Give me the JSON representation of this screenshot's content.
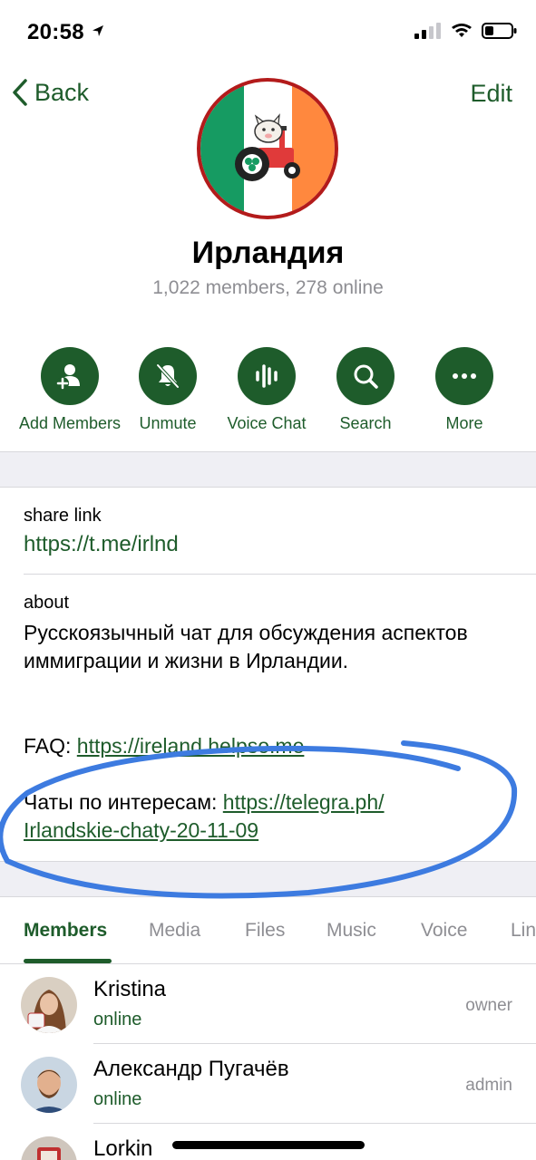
{
  "status_bar": {
    "time": "20:58"
  },
  "nav": {
    "back_label": "Back",
    "edit_label": "Edit"
  },
  "group": {
    "title": "Ирландия",
    "subtitle": "1,022 members, 278 online"
  },
  "actions": [
    {
      "label": "Add Members",
      "icon": "add-member-icon"
    },
    {
      "label": "Unmute",
      "icon": "bell-slash-icon"
    },
    {
      "label": "Voice Chat",
      "icon": "waveform-icon"
    },
    {
      "label": "Search",
      "icon": "magnifier-icon"
    },
    {
      "label": "More",
      "icon": "ellipsis-icon"
    }
  ],
  "info": {
    "share_link_label": "share link",
    "share_link": "https://t.me/irlnd",
    "about_label": "about",
    "about_text": "Русскоязычный чат для обсуждения аспектов иммиграции и жизни в Ирландии.",
    "faq_prefix": "FAQ: ",
    "faq_link": "https://ireland.helpso.me",
    "chats_prefix": "Чаты по интересам: ",
    "chats_link_line1": "https://telegra.ph/",
    "chats_link_line2": "Irlandskie-chaty-20-11-09"
  },
  "tabs": [
    {
      "label": "Members",
      "active": true
    },
    {
      "label": "Media"
    },
    {
      "label": "Files"
    },
    {
      "label": "Music"
    },
    {
      "label": "Voice"
    },
    {
      "label": "Links"
    }
  ],
  "members": [
    {
      "name": "Kristina",
      "status": "online",
      "role": "owner"
    },
    {
      "name": "Александр Пугачёв",
      "status": "online",
      "role": "admin"
    },
    {
      "name": "Lorkin",
      "status": "",
      "role": ""
    }
  ],
  "colors": {
    "accent": "#1e5c2b",
    "secondary_text": "#8e8e93",
    "annotation": "#3d7be0"
  }
}
